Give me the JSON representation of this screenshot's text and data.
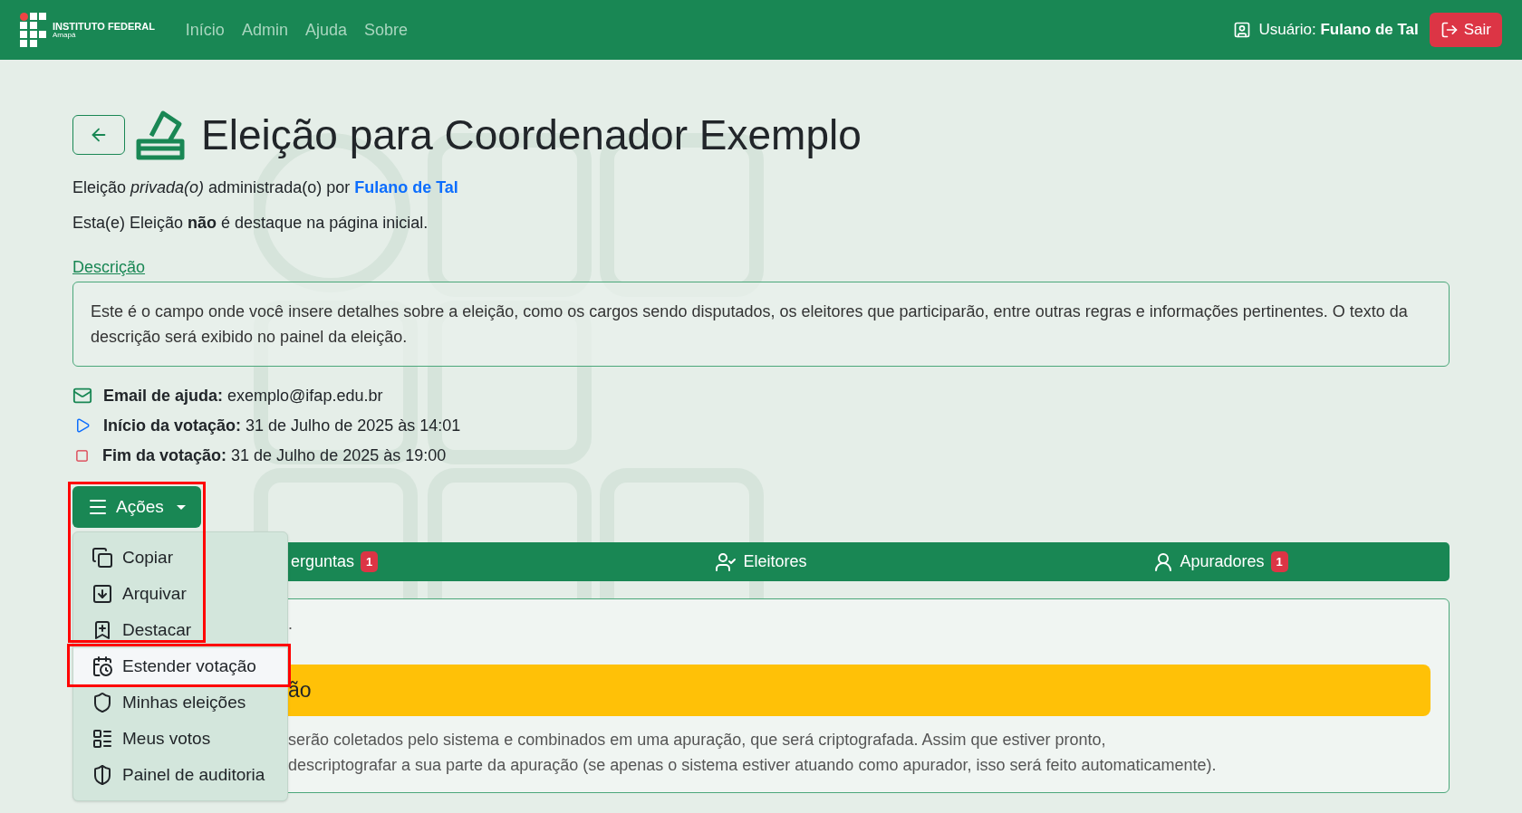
{
  "navbar": {
    "brand": "INSTITUTO FEDERAL",
    "brand_sub": "Amapá",
    "links": [
      {
        "label": "Início"
      },
      {
        "label": "Admin"
      },
      {
        "label": "Ajuda"
      },
      {
        "label": "Sobre"
      }
    ],
    "user_label": "Usuário:",
    "user_name": "Fulano de Tal",
    "logout": "Sair"
  },
  "header": {
    "title": "Eleição para Coordenador Exemplo"
  },
  "meta": {
    "admin_text": "Eleição *privada(o)* administrada(o) por",
    "admin_link": "Fulano de Tal",
    "featured_text": "Esta(e) Eleição **não** é destaque na página inicial."
  },
  "description": {
    "label": "Descrição",
    "text": "Este é o campo onde você insere detalhes sobre a eleição, como os cargos sendo disputados, os eleitores que participarão, entre outras regras e informações pertinentes. O texto da descrição será exibido no painel da eleição."
  },
  "info": [
    {
      "kind": "email",
      "label": "Email de ajuda:",
      "value": "exemplo@ifap.edu.br"
    },
    {
      "kind": "start",
      "label": "Início da votação:",
      "value": "31 de Julho de 2025 às 14:01"
    },
    {
      "kind": "end",
      "label": "Fim da votação:",
      "value": "31 de Julho de 2025 às 19:00"
    }
  ],
  "actions_menu": {
    "label": "Ações",
    "expanded": true,
    "highlighted": true,
    "items": [
      {
        "kind": "copy",
        "label": "Copiar",
        "selected": false,
        "highlighted": false
      },
      {
        "kind": "archive",
        "label": "Arquivar",
        "selected": false,
        "highlighted": false
      },
      {
        "kind": "feature",
        "label": "Destacar",
        "selected": false,
        "highlighted": false
      },
      {
        "kind": "extend",
        "label": "Estender votação",
        "selected": true,
        "highlighted": true
      },
      {
        "kind": "elections",
        "label": "Minhas eleições",
        "selected": false,
        "highlighted": false
      },
      {
        "kind": "votes",
        "label": "Meus votos",
        "selected": false,
        "highlighted": false
      },
      {
        "kind": "audit",
        "label": "Painel de auditoria",
        "selected": false,
        "highlighted": false
      }
    ]
  },
  "tabs": [
    {
      "kind": "questions",
      "label": "erguntas",
      "badge": "1"
    },
    {
      "kind": "voters",
      "label": "Eleitores"
    },
    {
      "kind": "tallies",
      "label": "Apuradores",
      "badge": "1"
    }
  ],
  "panel": {
    "intro": ".",
    "alert": "ão",
    "lines": [
      "serão coletados pelo sistema e combinados em uma apuração, que será criptografada. Assim que estiver pronto,",
      "descriptografar a sua parte da apuração (se apenas o sistema estiver atuando como apurador, isso será feito automaticamente)."
    ]
  }
}
